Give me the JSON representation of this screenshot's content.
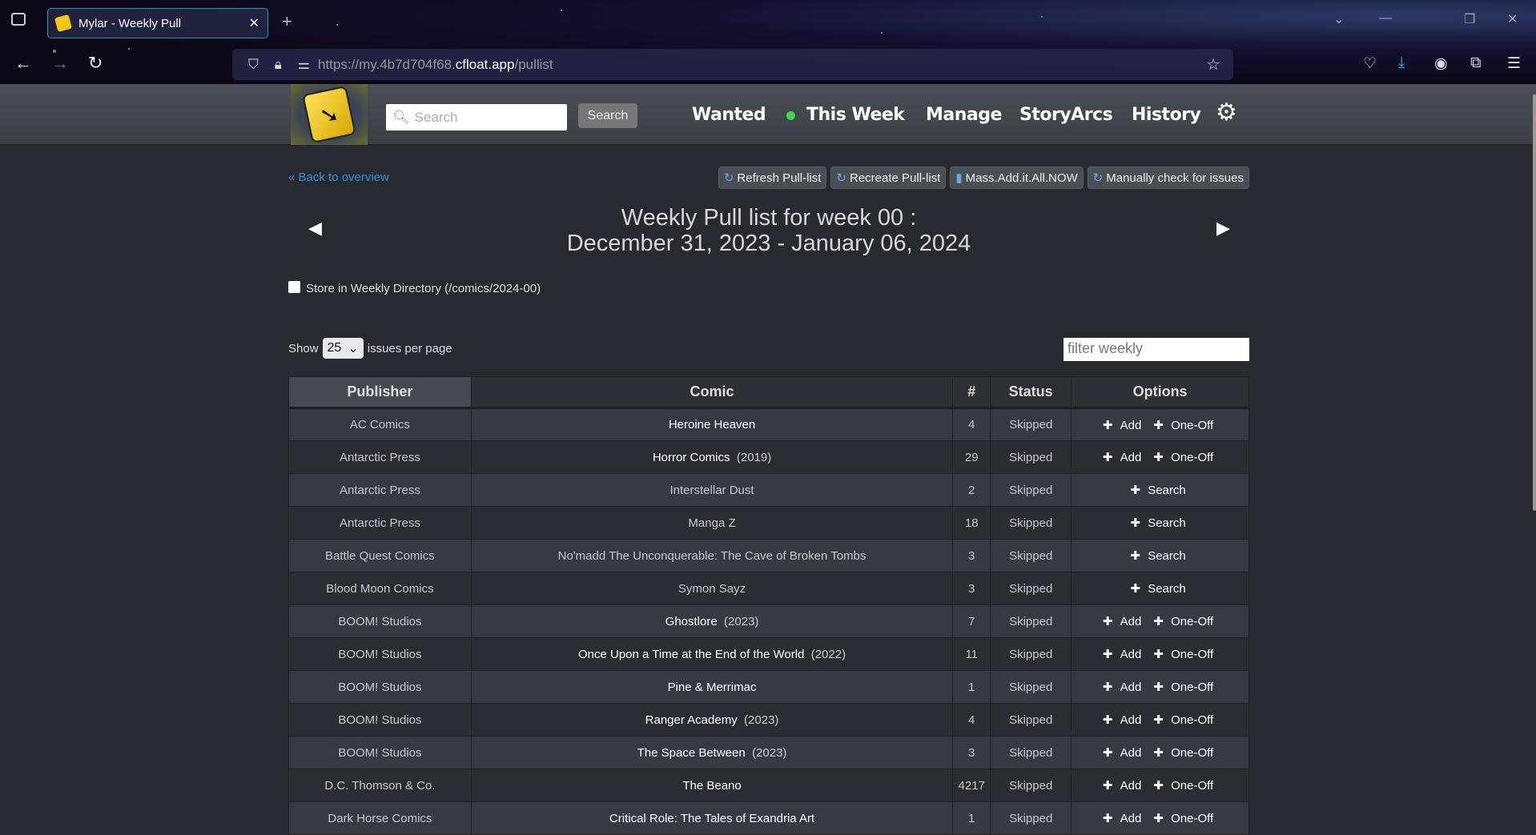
{
  "browser": {
    "tab_title": "Mylar - Weekly Pull",
    "url_prefix": "https://my.4b7d704f68.",
    "url_host": "cfloat.app",
    "url_path": "/pullist"
  },
  "header": {
    "search_placeholder": "Search",
    "search_button": "Search",
    "nav": [
      "Wanted",
      "This Week",
      "Manage",
      "StoryArcs",
      "History"
    ],
    "active_dot_color": "#48d448"
  },
  "page": {
    "back_link": "« Back to overview",
    "actions": [
      "Refresh Pull-list",
      "Recreate Pull-list",
      "Mass.Add.it.All.NOW",
      "Manually check for issues"
    ],
    "title_line1": "Weekly Pull list for week 00 :",
    "title_line2": "December 31, 2023 - January 06, 2024",
    "store_label": "Store in Weekly Directory (/comics/2024-00)",
    "store_checked": false,
    "show_label": "Show",
    "per_page": "25",
    "per_page_suffix": "issues per page",
    "filter_placeholder": "filter weekly"
  },
  "table": {
    "headers": [
      "Publisher",
      "Comic",
      "#",
      "Status",
      "Options"
    ],
    "rows": [
      {
        "publisher": "AC Comics",
        "comic": "Heroine Heaven",
        "year": "",
        "num": "4",
        "status": "Skipped",
        "options": [
          "Add",
          "One-Off"
        ]
      },
      {
        "publisher": "Antarctic Press",
        "comic": "Horror Comics",
        "year": "(2019)",
        "num": "29",
        "status": "Skipped",
        "options": [
          "Add",
          "One-Off"
        ]
      },
      {
        "publisher": "Antarctic Press",
        "comic": "Interstellar Dust",
        "year": "",
        "num": "2",
        "status": "Skipped",
        "options": [
          "Search"
        ]
      },
      {
        "publisher": "Antarctic Press",
        "comic": "Manga Z",
        "year": "",
        "num": "18",
        "status": "Skipped",
        "options": [
          "Search"
        ]
      },
      {
        "publisher": "Battle Quest Comics",
        "comic": "No'madd The Unconquerable: The Cave of Broken Tombs",
        "year": "",
        "num": "3",
        "status": "Skipped",
        "options": [
          "Search"
        ]
      },
      {
        "publisher": "Blood Moon Comics",
        "comic": "Symon Sayz",
        "year": "",
        "num": "3",
        "status": "Skipped",
        "options": [
          "Search"
        ]
      },
      {
        "publisher": "BOOM! Studios",
        "comic": "Ghostlore",
        "year": "(2023)",
        "num": "7",
        "status": "Skipped",
        "options": [
          "Add",
          "One-Off"
        ]
      },
      {
        "publisher": "BOOM! Studios",
        "comic": "Once Upon a Time at the End of the World",
        "year": "(2022)",
        "num": "11",
        "status": "Skipped",
        "options": [
          "Add",
          "One-Off"
        ]
      },
      {
        "publisher": "BOOM! Studios",
        "comic": "Pine & Merrimac",
        "year": "",
        "num": "1",
        "status": "Skipped",
        "options": [
          "Add",
          "One-Off"
        ]
      },
      {
        "publisher": "BOOM! Studios",
        "comic": "Ranger Academy",
        "year": "(2023)",
        "num": "4",
        "status": "Skipped",
        "options": [
          "Add",
          "One-Off"
        ]
      },
      {
        "publisher": "BOOM! Studios",
        "comic": "The Space Between",
        "year": "(2023)",
        "num": "3",
        "status": "Skipped",
        "options": [
          "Add",
          "One-Off"
        ]
      },
      {
        "publisher": "D.C. Thomson & Co.",
        "comic": "The Beano",
        "year": "",
        "num": "4217",
        "status": "Skipped",
        "options": [
          "Add",
          "One-Off"
        ]
      },
      {
        "publisher": "Dark Horse Comics",
        "comic": "Critical Role: The Tales of Exandria Art",
        "year": "",
        "num": "1",
        "status": "Skipped",
        "options": [
          "Add",
          "One-Off"
        ]
      }
    ]
  }
}
